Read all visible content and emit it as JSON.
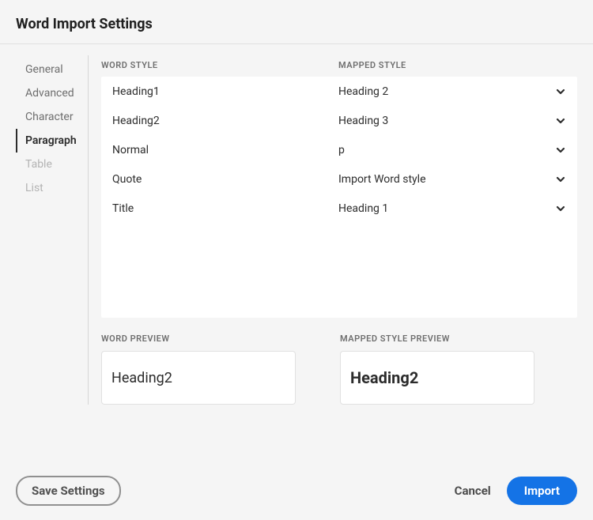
{
  "title": "Word Import Settings",
  "sidebar": {
    "items": [
      {
        "label": "General",
        "active": false,
        "disabled": false
      },
      {
        "label": "Advanced",
        "active": false,
        "disabled": false
      },
      {
        "label": "Character",
        "active": false,
        "disabled": false
      },
      {
        "label": "Paragraph",
        "active": true,
        "disabled": false
      },
      {
        "label": "Table",
        "active": false,
        "disabled": true
      },
      {
        "label": "List",
        "active": false,
        "disabled": true
      }
    ]
  },
  "columns": {
    "word": "WORD STYLE",
    "mapped": "MAPPED STYLE"
  },
  "mappings": [
    {
      "word": "Heading1",
      "mapped": "Heading 2"
    },
    {
      "word": "Heading2",
      "mapped": "Heading 3"
    },
    {
      "word": "Normal",
      "mapped": "p"
    },
    {
      "word": "Quote",
      "mapped": "Import Word style"
    },
    {
      "word": "Title",
      "mapped": "Heading 1"
    }
  ],
  "preview": {
    "word_label": "WORD PREVIEW",
    "mapped_label": "MAPPED STYLE PREVIEW",
    "word_text": "Heading2",
    "mapped_text": "Heading2"
  },
  "footer": {
    "save": "Save Settings",
    "cancel": "Cancel",
    "import": "Import"
  }
}
